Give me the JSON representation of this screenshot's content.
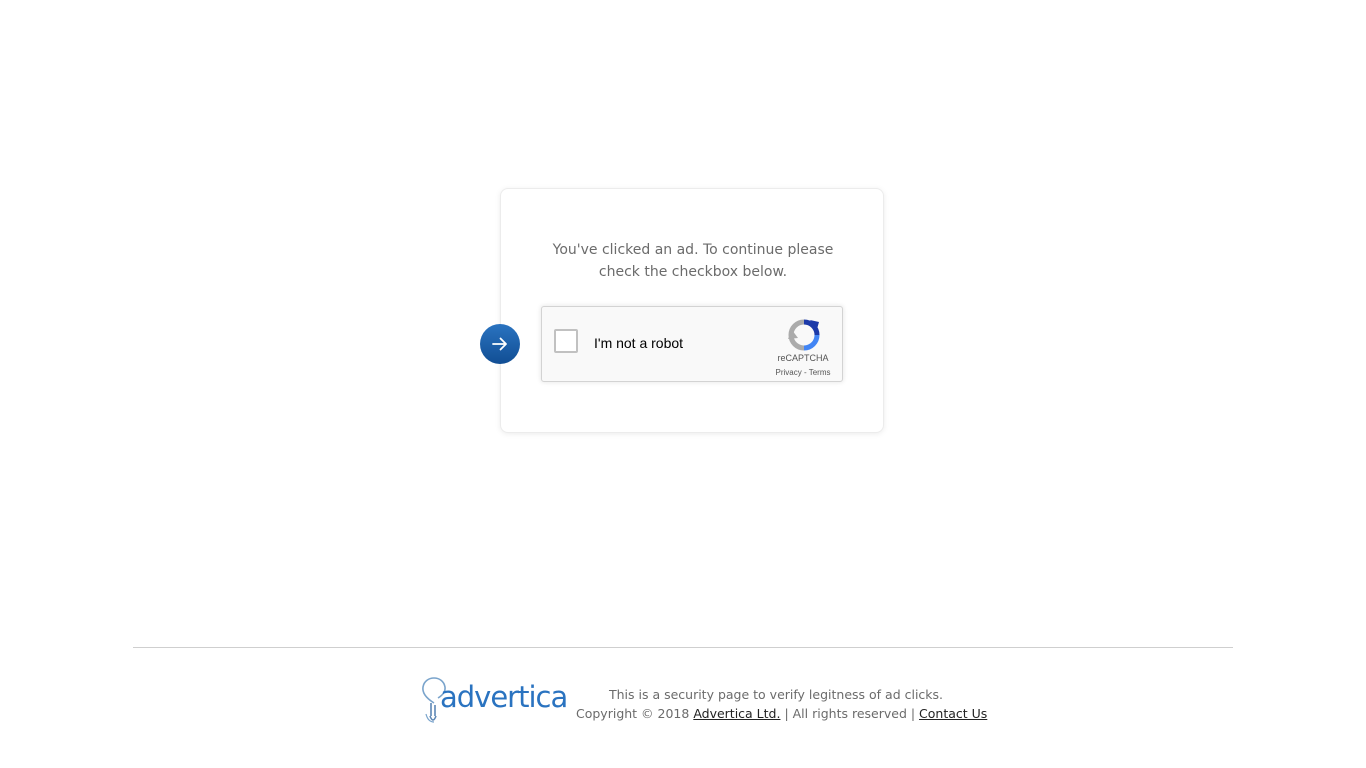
{
  "card": {
    "message_line1": "You've clicked an ad. To continue please",
    "message_line2": "check the checkbox below."
  },
  "recaptcha": {
    "checkbox_label": "I'm not a robot",
    "brand": "reCAPTCHA",
    "privacy_link": "Privacy",
    "separator": " - ",
    "terms_link": "Terms",
    "checked": false
  },
  "arrow_button": {
    "icon": "arrow-right-icon",
    "color": "#1d62ad"
  },
  "footer": {
    "logo_text": "advertica",
    "logo_icon": "lightbulb-icon",
    "line1": "This is a security page to verify legitness of ad clicks.",
    "copyright_prefix": "Copyright © 2018 ",
    "company_link": "Advertica Ltd.",
    "rights_text": " | All rights reserved | ",
    "contact_link": "Contact Us"
  },
  "colors": {
    "accent": "#2a73c0",
    "text_gray": "#6b6b6b"
  }
}
